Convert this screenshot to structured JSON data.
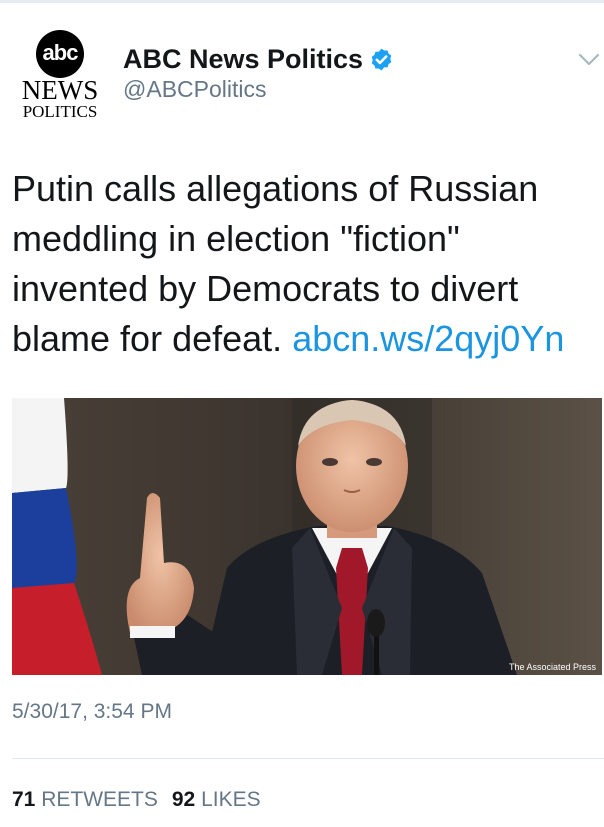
{
  "avatar": {
    "logo_text": "abc",
    "news_text": "NEWS",
    "sub_text": "POLITICS"
  },
  "account": {
    "display_name": "ABC News Politics",
    "handle": "@ABCPolitics",
    "verified": true
  },
  "icons": {
    "verified": "verified-badge-icon",
    "menu": "chevron-down-icon"
  },
  "tweet": {
    "text": "Putin calls allegations of Russian meddling in election \"fiction\" invented by Democrats to divert blame for defeat.",
    "link_text": "abcn.ws/2qyj0Yn"
  },
  "media": {
    "credit": "The Associated Press"
  },
  "timestamp": "5/30/17, 3:54 PM",
  "stats": {
    "retweets_count": "71",
    "retweets_label": "RETWEETS",
    "likes_count": "92",
    "likes_label": "LIKES"
  },
  "colors": {
    "link": "#1b95e0",
    "secondary_text": "#657786",
    "verified": "#1da1f2"
  }
}
